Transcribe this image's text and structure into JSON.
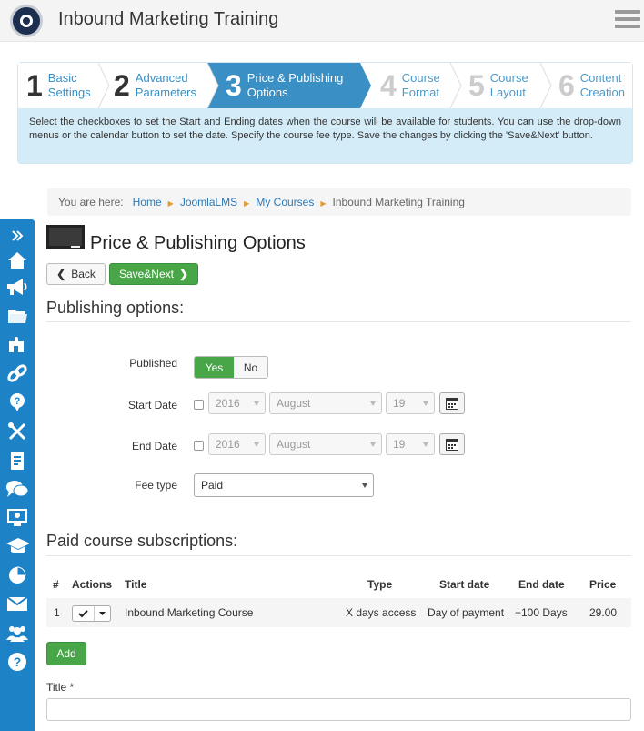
{
  "header": {
    "title": "Inbound Marketing Training",
    "logo_icon": "logo-icon",
    "menu_icon": "hamburger-icon"
  },
  "wizard": {
    "steps": [
      {
        "num": "1",
        "line1": "Basic",
        "line2": "Settings",
        "state": "done"
      },
      {
        "num": "2",
        "line1": "Advanced",
        "line2": "Parameters",
        "state": "done"
      },
      {
        "num": "3",
        "line1": "Price & Publishing",
        "line2": "Options",
        "state": "active"
      },
      {
        "num": "4",
        "line1": "Course",
        "line2": "Format",
        "state": "future"
      },
      {
        "num": "5",
        "line1": "Course",
        "line2": "Layout",
        "state": "future"
      },
      {
        "num": "6",
        "line1": "Content",
        "line2": "Creation",
        "state": "future"
      }
    ],
    "description": "Select the checkboxes to set the Start and Ending dates when the course will be available for students. You can use the drop-down menus or the calendar button to set the date. Specify the course fee type. Save the changes by clicking the 'Save&Next' button."
  },
  "breadcrumb": {
    "prefix": "You are here:",
    "items": [
      "Home",
      "JoomlaLMS",
      "My Courses"
    ],
    "current": "Inbound Marketing Training"
  },
  "page": {
    "title": "Price & Publishing Options",
    "back_label": "Back",
    "next_label": "Save&Next"
  },
  "publishing": {
    "section_title": "Publishing options:",
    "published_label": "Published",
    "yes_label": "Yes",
    "no_label": "No",
    "start_label": "Start Date",
    "end_label": "End Date",
    "start": {
      "year": "2016",
      "month": "August",
      "day": "19"
    },
    "end": {
      "year": "2016",
      "month": "August",
      "day": "19"
    },
    "fee_label": "Fee type",
    "fee_value": "Paid"
  },
  "subscriptions": {
    "section_title": "Paid course subscriptions:",
    "columns": [
      "#",
      "Actions",
      "Title",
      "Type",
      "Start date",
      "End date",
      "Price"
    ],
    "rows": [
      {
        "num": "1",
        "title": "Inbound Marketing Course",
        "type": "X days access",
        "start": "Day of payment",
        "end": "+100 Days",
        "price": "29.00"
      }
    ],
    "add_label": "Add",
    "title_field_label": "Title *"
  },
  "sidebar": {
    "icons": [
      "expand-icon",
      "home-icon",
      "megaphone-icon",
      "folder-icon",
      "puzzle-icon",
      "link-icon",
      "help-bubble-icon",
      "tools-icon",
      "document-icon",
      "chat-icon",
      "monitor-icon",
      "graduation-cap-icon",
      "pie-chart-icon",
      "mail-icon",
      "users-icon",
      "question-icon"
    ]
  },
  "colors": {
    "primary": "#3a8fc4",
    "sidebar": "#1d83c6",
    "success": "#48a648",
    "info_bg": "#d4ecf8"
  }
}
